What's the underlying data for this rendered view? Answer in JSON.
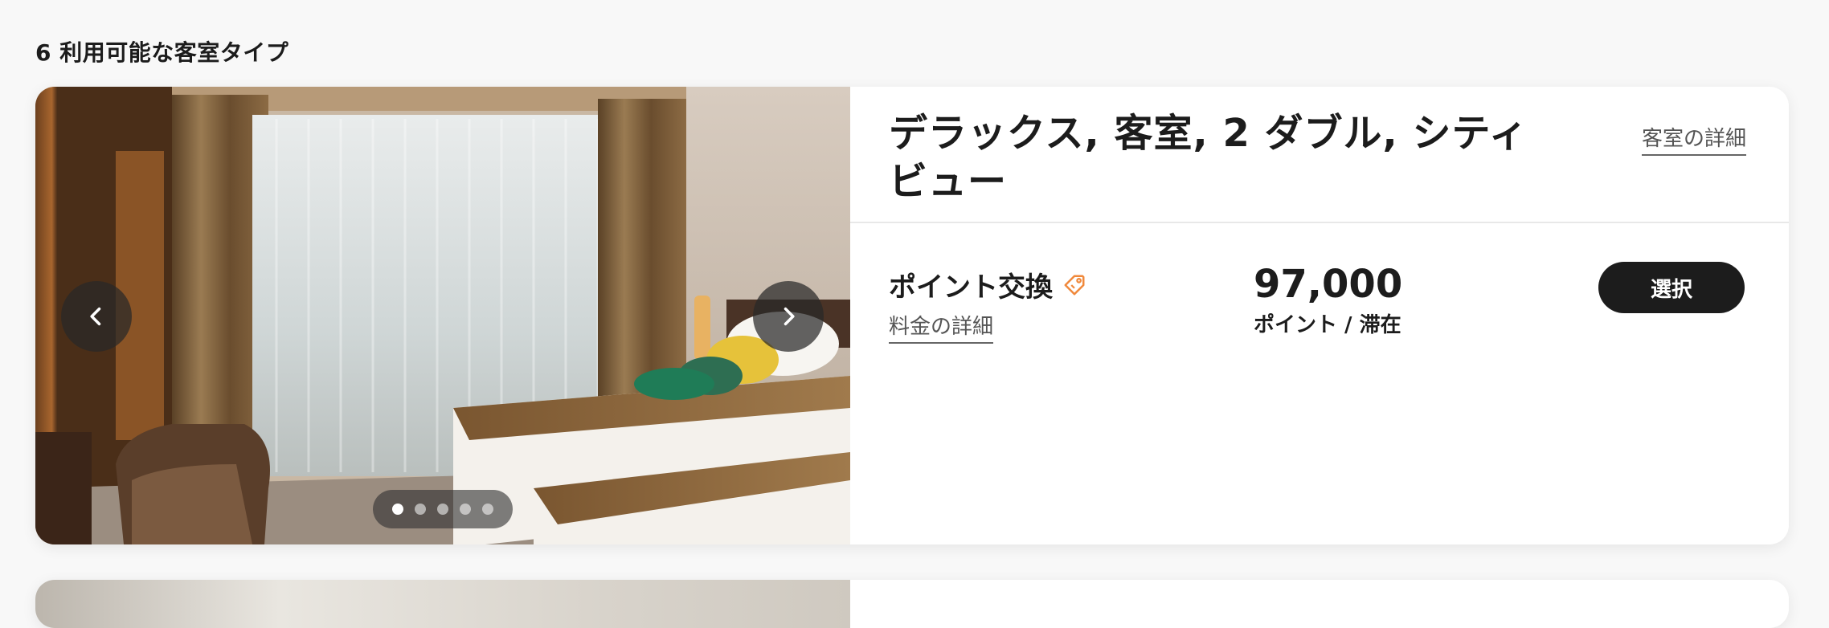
{
  "section": {
    "title": "6 利用可能な客室タイプ"
  },
  "room": {
    "name": "デラックス, 客室, 2 ダブル, シティビュー",
    "details_link": "客室の詳細",
    "carousel": {
      "dot_count": 5,
      "active_index": 0
    }
  },
  "rate": {
    "title": "ポイント交換",
    "details_link": "料金の詳細",
    "price": "97,000",
    "price_unit": "ポイント / 滞在",
    "select_label": "選択"
  },
  "icons": {
    "prev": "chevron-left-icon",
    "next": "chevron-right-icon",
    "tag": "tag-icon"
  },
  "colors": {
    "button_bg": "#1c1c1c",
    "tag_icon": "#f0893c"
  }
}
